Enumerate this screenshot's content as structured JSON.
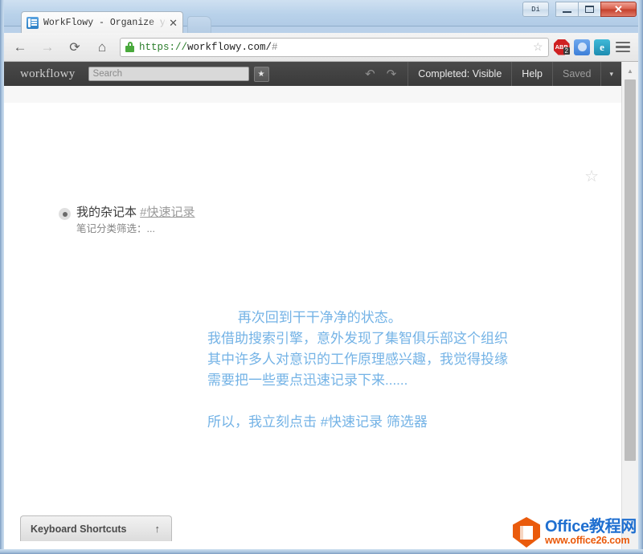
{
  "window": {
    "buttons": {
      "extra_label": "Di",
      "minimize_label": "",
      "maximize_label": "",
      "close_label": "✕"
    }
  },
  "browser": {
    "tab": {
      "title": "WorkFlowy - Organize yo",
      "close_label": "✕",
      "favicon_name": "workflowy-favicon"
    },
    "new_tab_label": "",
    "nav": {
      "back_label": "←",
      "forward_label": "→",
      "reload_label": "⟳",
      "home_label": "⌂"
    },
    "omnibox": {
      "scheme": "https://",
      "host_path": "workflowy.com/",
      "fragment": "#",
      "bookmark_star": "☆",
      "lock_name": "secure-lock-icon"
    },
    "extensions": [
      {
        "name": "adblock-plus-icon",
        "label": "ABP",
        "badge": "2"
      },
      {
        "name": "blue-circle-extension-icon",
        "label": ""
      },
      {
        "name": "teal-e-extension-icon",
        "label": "e"
      }
    ],
    "menu_label": ""
  },
  "workflowy": {
    "logo": "workflowy",
    "search_placeholder": "Search",
    "search_value": "",
    "star_button_label": "★",
    "undo_label": "↶",
    "redo_label": "↷",
    "completed_label": "Completed: Visible",
    "help_label": "Help",
    "saved_label": "Saved",
    "caret_label": "▾",
    "page_star": "☆",
    "outline": {
      "item_text": "我的杂记本 ",
      "item_tag": "#快速记录",
      "item_note": "笔记分类筛选：..."
    },
    "annotation": {
      "paragraph1_lines": [
        "再次回到干干净净的状态。",
        "我借助搜索引擎，意外发现了集智俱乐部这个组织",
        "其中许多人对意识的工作原理感兴趣，我觉得投缘",
        "需要把一些要点迅速记录下来......"
      ],
      "paragraph2": "所以，我立刻点击 #快速记录 筛选器",
      "color": "#74b3e6"
    },
    "keyboard_shortcuts_label": "Keyboard Shortcuts",
    "keyboard_shortcuts_arrow": "↑",
    "scrollbar_up_arrow": "▲"
  },
  "watermark": {
    "title": "Office教程网",
    "url": "www.office26.com",
    "logo_name": "office-hexagon-logo",
    "accent_blue": "#1f6fd0",
    "accent_orange": "#ea5b0c"
  }
}
